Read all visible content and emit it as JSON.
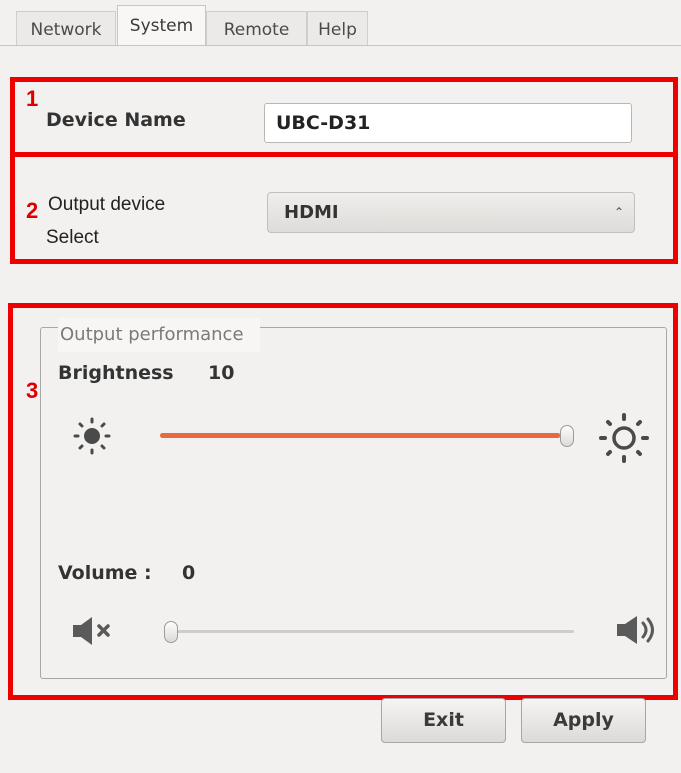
{
  "tabs": [
    {
      "label": "Network"
    },
    {
      "label": "System"
    },
    {
      "label": "Remote"
    },
    {
      "label": "Help"
    }
  ],
  "annotations": {
    "one": "1",
    "two": "2",
    "three": "3"
  },
  "device_name": {
    "label": "Device Name",
    "value": "UBC-D31"
  },
  "output_device": {
    "label_line1": "Output device",
    "label_line2": "Select",
    "selected": "HDMI"
  },
  "performance": {
    "legend": "Output performance",
    "brightness": {
      "label": "Brightness",
      "value": "10",
      "level": 1.0
    },
    "volume": {
      "label": "Volume :",
      "value": "0",
      "level": 0.0
    }
  },
  "buttons": {
    "exit": "Exit",
    "apply": "Apply"
  },
  "colors": {
    "highlight_red": "#ee0000",
    "slider_fill": "#e8693f",
    "slider_empty": "#cfcdca"
  },
  "icons": [
    "sun-small-icon",
    "sun-large-icon",
    "speaker-mute-icon",
    "speaker-volume-icon",
    "combo-arrows-icon"
  ]
}
